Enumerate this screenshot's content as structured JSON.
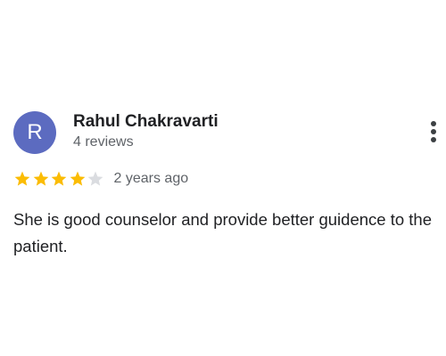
{
  "review": {
    "avatar_letter": "R",
    "reviewer_name": "Rahul Chakravarti",
    "review_count": "4 reviews",
    "rating": 4,
    "rating_max": 5,
    "time_ago": "2 years ago",
    "text": "She is good counselor and provide better guidence to the patient."
  },
  "colors": {
    "avatar": "#5c6bc0",
    "star_filled": "#fbbc04",
    "star_empty": "#dadce0",
    "text_primary": "#202124",
    "text_secondary": "#5f6368"
  },
  "icons": {
    "more": "more-vert-icon",
    "star": "star-icon"
  }
}
